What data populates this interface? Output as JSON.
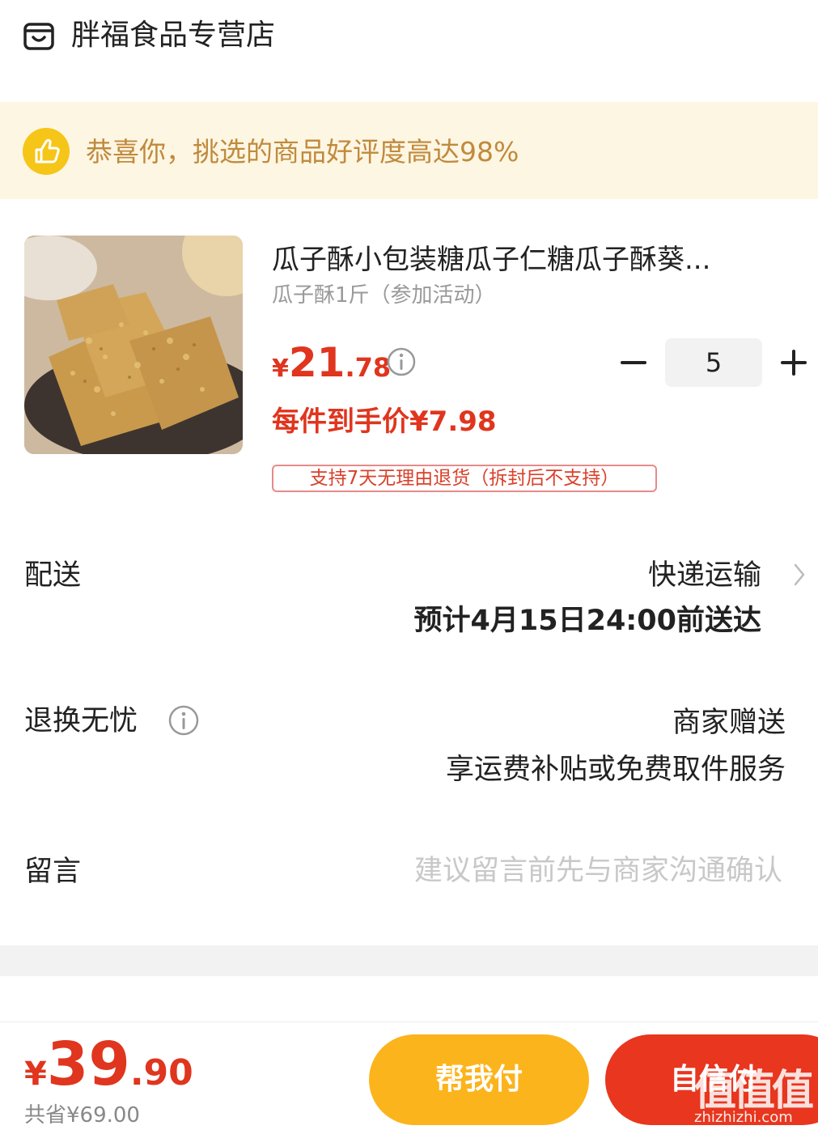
{
  "header": {
    "store_name": "胖福食品专营店",
    "store_icon": "store-icon"
  },
  "banner": {
    "icon": "thumbs-up-icon",
    "text": "恭喜你，挑选的商品好评度高达98%"
  },
  "product": {
    "title": "瓜子酥小包装糖瓜子仁糖瓜子酥葵...",
    "variant": "瓜子酥1斤（参加活动）",
    "price_symbol": "¥",
    "price_int": "21",
    "price_dec": ".78",
    "per_item_price": "每件到手价¥7.98",
    "return_tag": "支持7天无理由退货（拆封后不支持）",
    "quantity": "5"
  },
  "delivery": {
    "label": "配送",
    "method": "快递运输",
    "eta": "预计4月15日24:00前送达"
  },
  "returns": {
    "label": "退换无忧",
    "gift": "商家赠送",
    "desc": "享运费补贴或免费取件服务"
  },
  "message": {
    "label": "留言",
    "placeholder": "建议留言前先与商家沟通确认"
  },
  "footer": {
    "total_symbol": "¥",
    "total_int": "39",
    "total_dec": ".90",
    "saved": "共省¥69.00",
    "help_pay_label": "帮我付",
    "pay_label": "自信付"
  },
  "watermark": {
    "logo_text": "值值值",
    "url": "zhizhizhi.com"
  },
  "colors": {
    "accent_red": "#e0351e",
    "banner_bg": "#fdf6e3",
    "banner_text": "#c08a3d",
    "help_button": "#fbb41c",
    "pay_button": "#e8361f"
  }
}
